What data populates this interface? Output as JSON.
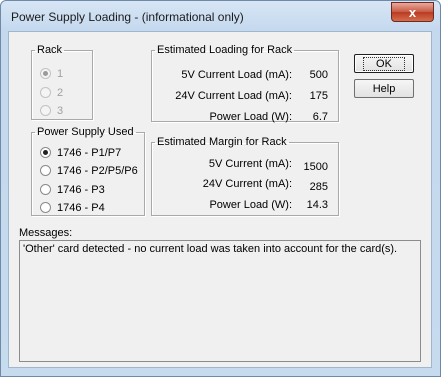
{
  "window": {
    "title": "Power Supply Loading  -  (informational only)",
    "close_glyph": "x"
  },
  "rack": {
    "legend": "Rack",
    "options": [
      {
        "label": "1",
        "selected": true
      },
      {
        "label": "2",
        "selected": false
      },
      {
        "label": "3",
        "selected": false
      }
    ]
  },
  "power_supply": {
    "legend": "Power Supply Used",
    "options": [
      {
        "label": "1746 - P1/P7",
        "selected": true
      },
      {
        "label": "1746 - P2/P5/P6",
        "selected": false
      },
      {
        "label": "1746 - P3",
        "selected": false
      },
      {
        "label": "1746 - P4",
        "selected": false
      }
    ]
  },
  "loading": {
    "legend": "Estimated Loading for Rack",
    "rows": [
      {
        "label": "5V Current Load (mA):",
        "value": "500"
      },
      {
        "label": "24V Current Load (mA):",
        "value": "175"
      },
      {
        "label": "Power Load (W):",
        "value": "6.7"
      }
    ]
  },
  "margin": {
    "legend": "Estimated Margin for Rack",
    "rows": [
      {
        "label": "5V Current (mA):",
        "value": "1500"
      },
      {
        "label": "24V Current (mA):",
        "value": "285"
      },
      {
        "label": "Power Load (W):",
        "value": "14.3"
      }
    ]
  },
  "buttons": {
    "ok": "OK",
    "help": "Help"
  },
  "messages": {
    "label": "Messages:",
    "text": "'Other' card detected - no current load was taken into account for the card(s)."
  }
}
